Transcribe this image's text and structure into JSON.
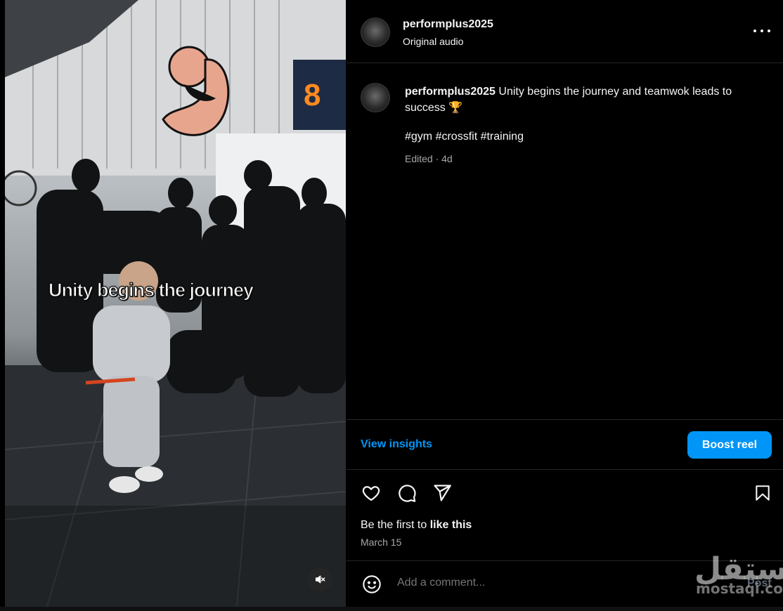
{
  "media": {
    "overlay_text": "Unity begins the journey",
    "mute_icon": "speaker-muted-icon"
  },
  "header": {
    "username": "performplus2025",
    "audio_label": "Original audio",
    "more_icon": "more-horizontal-icon"
  },
  "caption": {
    "username": "performplus2025",
    "text": "Unity begins the journey and teamwok leads to success 🏆",
    "hashtags": "#gym #crossfit #training",
    "meta": "Edited · 4d"
  },
  "actions": {
    "insights_label": "View insights",
    "boost_label": "Boost reel",
    "like_icon": "heart-icon",
    "comment_icon": "comment-icon",
    "share_icon": "send-icon",
    "save_icon": "bookmark-icon"
  },
  "likes": {
    "prefix": "Be the first to ",
    "link": "like this"
  },
  "date": "March 15",
  "comment": {
    "placeholder": "Add a comment...",
    "post_label": "Post",
    "emoji_icon": "smiley-icon"
  },
  "watermark": {
    "arabic": "مستقل",
    "latin": "mostaqi.com"
  },
  "colors": {
    "background": "#000000",
    "accent": "#0095f6",
    "muted_text": "#a8a8a8",
    "divider": "#262626"
  }
}
